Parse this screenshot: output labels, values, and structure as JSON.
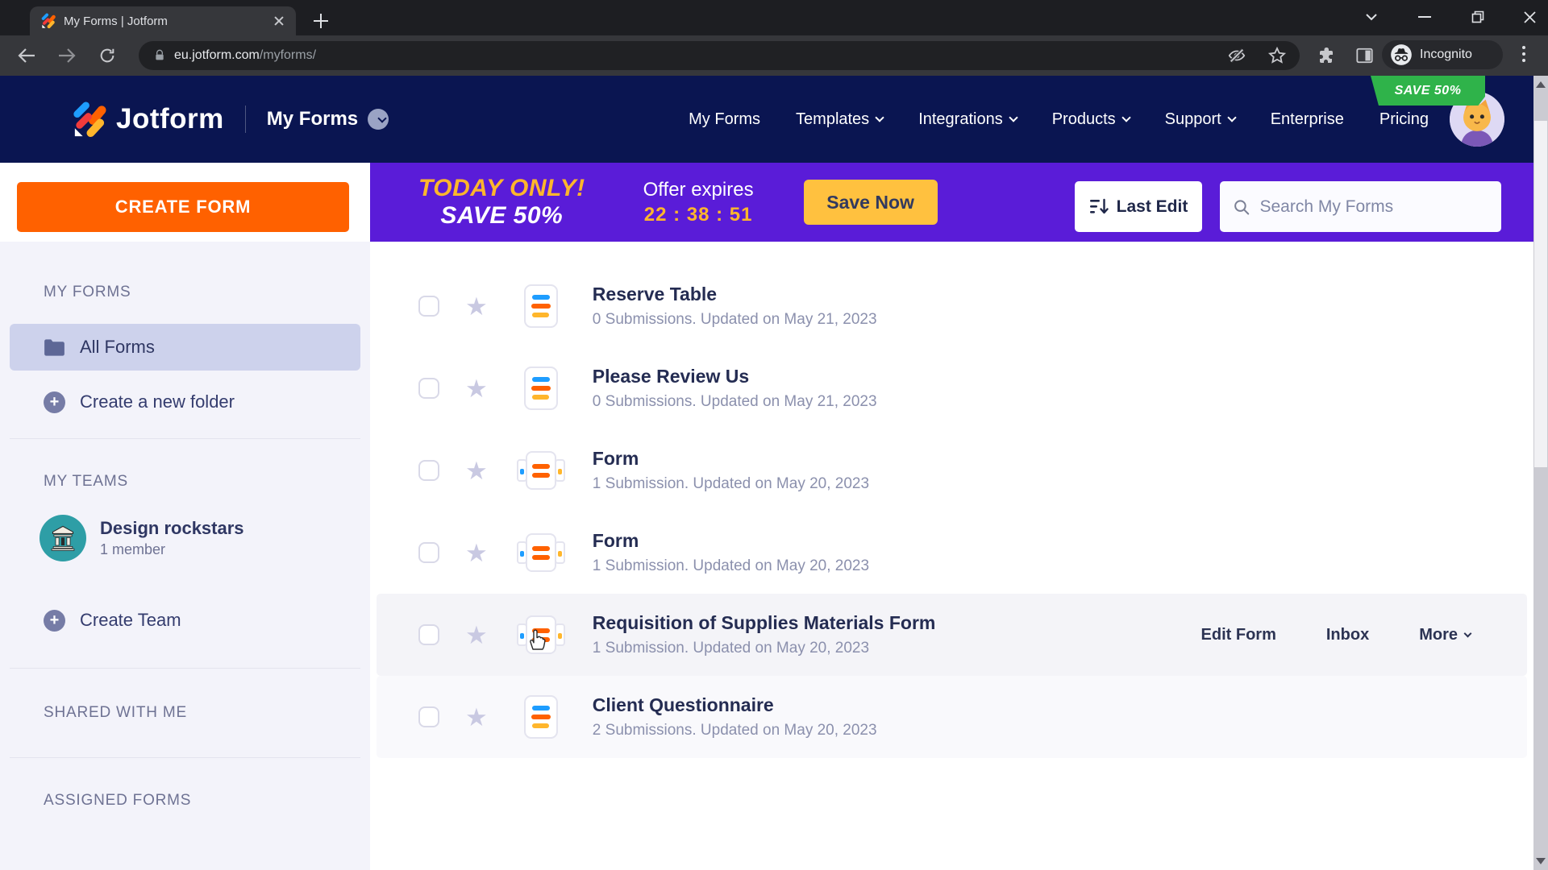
{
  "browser": {
    "tab_title": "My Forms | Jotform",
    "url_host": "eu.jotform.com",
    "url_path": "/myforms/",
    "incognito_label": "Incognito"
  },
  "navbar": {
    "logo_text": "Jotform",
    "workspace": "My Forms",
    "items": [
      {
        "label": "My Forms",
        "dropdown": false
      },
      {
        "label": "Templates",
        "dropdown": true
      },
      {
        "label": "Integrations",
        "dropdown": true
      },
      {
        "label": "Products",
        "dropdown": true
      },
      {
        "label": "Support",
        "dropdown": true
      },
      {
        "label": "Enterprise",
        "dropdown": false
      },
      {
        "label": "Pricing",
        "dropdown": false
      }
    ],
    "save_badge": "SAVE 50%"
  },
  "promo": {
    "headline": "TODAY ONLY!",
    "subline": "SAVE 50%",
    "expires_label": "Offer expires",
    "countdown": "22 : 38 : 51",
    "cta": "Save Now"
  },
  "listbar": {
    "sort_label": "Last Edit",
    "search_placeholder": "Search My Forms"
  },
  "sidebar": {
    "create_form": "CREATE FORM",
    "my_forms_header": "MY FORMS",
    "all_forms": "All Forms",
    "create_folder": "Create a new folder",
    "my_teams_header": "MY TEAMS",
    "team_name": "Design rockstars",
    "team_members": "1 member",
    "create_team": "Create Team",
    "shared_header": "SHARED WITH ME",
    "assigned_header": "ASSIGNED FORMS"
  },
  "row_actions": {
    "edit": "Edit Form",
    "inbox": "Inbox",
    "more": "More"
  },
  "forms": [
    {
      "title": "Reserve Table",
      "meta": "0 Submissions. Updated on May 21, 2023",
      "icon": "classic",
      "state": "default"
    },
    {
      "title": "Please Review Us",
      "meta": "0 Submissions. Updated on May 21, 2023",
      "icon": "classic",
      "state": "default"
    },
    {
      "title": "Form",
      "meta": "1 Submission. Updated on May 20, 2023",
      "icon": "card",
      "state": "default"
    },
    {
      "title": "Form",
      "meta": "1 Submission. Updated on May 20, 2023",
      "icon": "card",
      "state": "default"
    },
    {
      "title": "Requisition of Supplies Materials Form",
      "meta": "1 Submission. Updated on May 20, 2023",
      "icon": "card",
      "state": "hover"
    },
    {
      "title": "Client Questionnaire",
      "meta": "2 Submissions. Updated on May 20, 2023",
      "icon": "classic",
      "state": "subtle"
    }
  ],
  "colors": {
    "navy": "#0a1551",
    "purple": "#5a1cd8",
    "orange": "#ff6100",
    "cta_yellow": "#ffc13f",
    "accent_yellow": "#ffb62c",
    "badge_green": "#2fb34a"
  }
}
